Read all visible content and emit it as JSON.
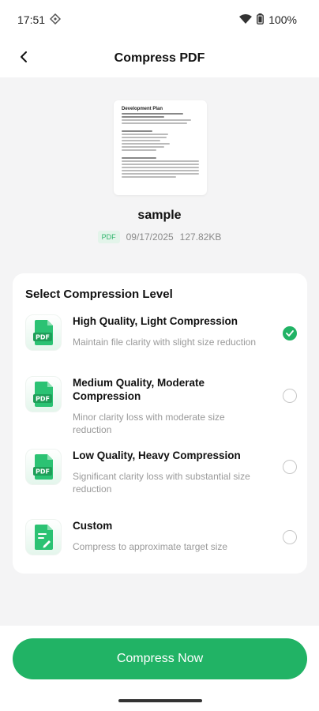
{
  "status": {
    "time": "17:51",
    "battery": "100%"
  },
  "header": {
    "title": "Compress PDF"
  },
  "file": {
    "name": "sample",
    "type_badge": "PDF",
    "date": "09/17/2025",
    "size": "127.82KB",
    "preview_heading": "Development Plan"
  },
  "card": {
    "title": "Select Compression Level",
    "options": [
      {
        "title": "High Quality, Light Compression",
        "desc": "Maintain file clarity with slight size reduction",
        "icon": "pdf-doc-icon",
        "selected": true
      },
      {
        "title": "Medium Quality, Moderate Compression",
        "desc": "Minor clarity loss with moderate size reduction",
        "icon": "pdf-doc-icon",
        "selected": false
      },
      {
        "title": "Low Quality, Heavy Compression",
        "desc": "Significant clarity loss with substantial size reduction",
        "icon": "pdf-doc-icon",
        "selected": false
      },
      {
        "title": "Custom",
        "desc": "Compress to approximate target size",
        "icon": "custom-edit-doc-icon",
        "selected": false
      }
    ]
  },
  "action": {
    "label": "Compress Now"
  },
  "colors": {
    "accent": "#21b365",
    "background": "#f4f4f5"
  }
}
